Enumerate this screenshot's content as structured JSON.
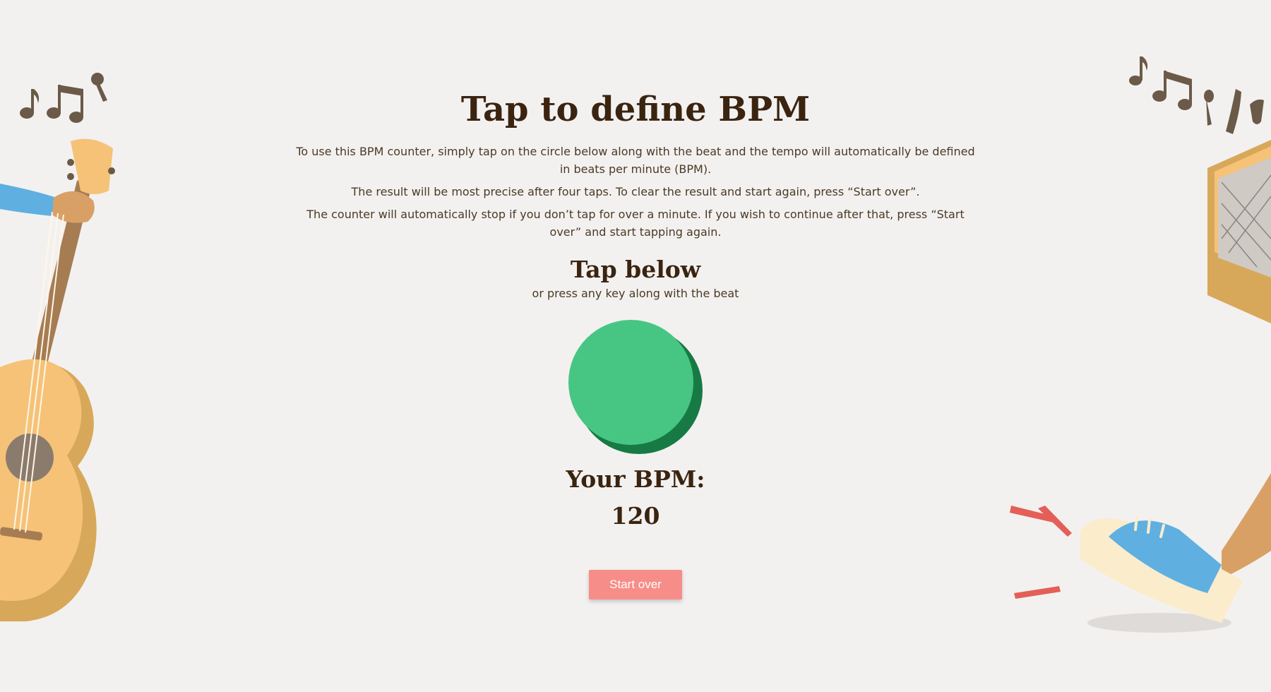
{
  "title": "Tap to define BPM",
  "intro": [
    "To use this BPM counter, simply tap on the circle below along with the beat and the tempo will automatically be defined in beats per minute (BPM).",
    "The result will be most precise after four taps. To clear the result and start again, press “Start over”.",
    "The counter will automatically stop if you don’t tap for over a minute. If you wish to continue after that, press “Start over” and start tapping again."
  ],
  "tap": {
    "heading": "Tap below",
    "subheading": "or press any key along with the beat"
  },
  "result": {
    "label": "Your BPM:",
    "value": "120"
  },
  "buttons": {
    "start_over": "Start over"
  },
  "colors": {
    "background": "#f3f1f0",
    "tap_circle": "#47c683",
    "tap_circle_shadow": "#177a45",
    "start_button": "#f78d88",
    "heading_text": "#3a2410"
  },
  "decorations": {
    "left": "guitar-illustration",
    "right_top": "amplifier-illustration",
    "right_bottom": "tapping-foot-illustration",
    "notes": "music-notes-icon"
  }
}
